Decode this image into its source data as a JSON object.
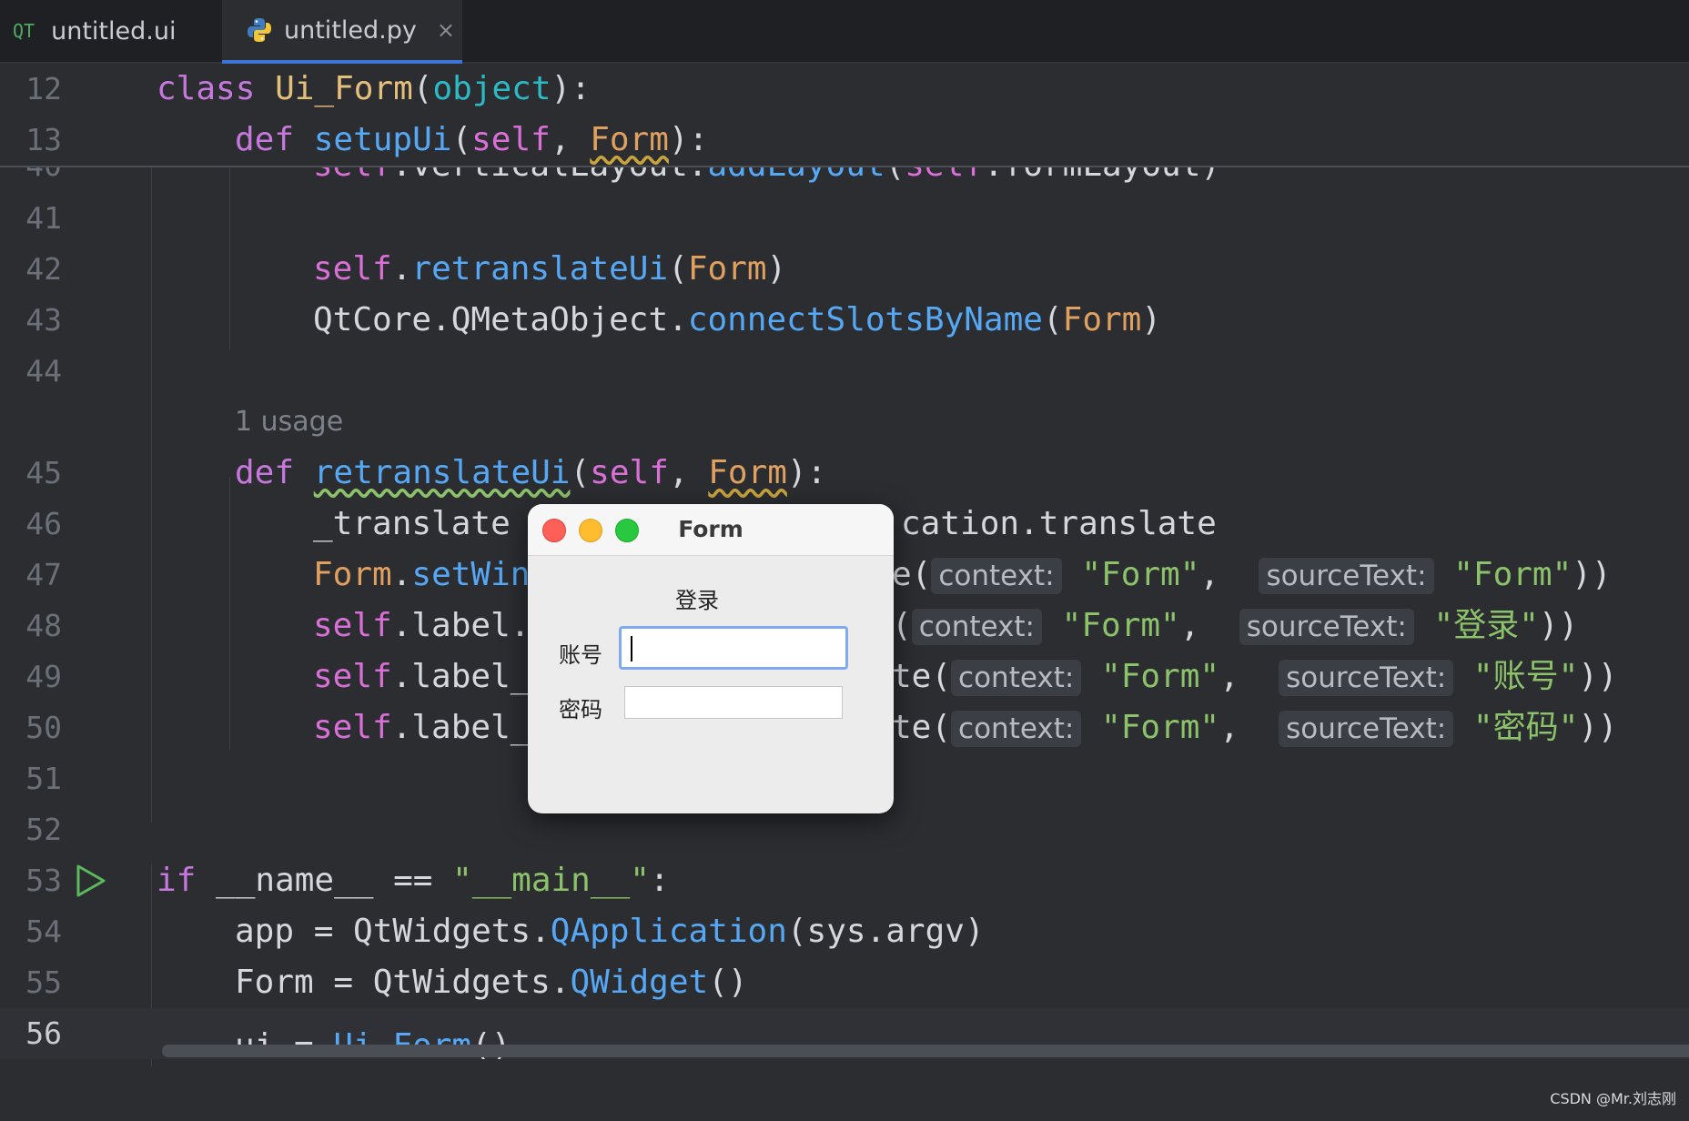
{
  "tabs": [
    {
      "label": "untitled.ui",
      "icon": "qt-icon",
      "icon_text": "QT",
      "active": false
    },
    {
      "label": "untitled.py",
      "icon": "python-icon",
      "active": true,
      "close": "×"
    }
  ],
  "sticky_lines": [
    {
      "num": "12"
    },
    {
      "num": "13"
    }
  ],
  "lines": {
    "l40": "40",
    "l41": "41",
    "l42": "42",
    "l43": "43",
    "l44": "44",
    "l45": "45",
    "l46": "46",
    "l47": "47",
    "l48": "48",
    "l49": "49",
    "l50": "50",
    "l51": "51",
    "l52": "52",
    "l53": "53",
    "l54": "54",
    "l55": "55",
    "l56": "56"
  },
  "code": {
    "c12_kw": "class",
    "c12_cls": "Ui_Form",
    "c12_p1": "(",
    "c12_bi": "object",
    "c12_p2": "):",
    "c13_kw": "def",
    "c13_fn": "setupUi",
    "c13_p1": "(",
    "c13_self": "self",
    "c13_comma": ", ",
    "c13_par": "Form",
    "c13_p2": "):",
    "c40_self": "self",
    "c40_a": ".verticalLayout.",
    "c40_fn": "addLayout",
    "c40_b": "(",
    "c40_self2": "self",
    "c40_c": ".formLayout)",
    "c42_self": "self",
    "c42_a": ".",
    "c42_fn": "retranslateUi",
    "c42_b": "(",
    "c42_par": "Form",
    "c42_c": ")",
    "c43_a": "QtCore.QMetaObject.",
    "c43_fn": "connectSlotsByName",
    "c43_b": "(",
    "c43_par": "Form",
    "c43_c": ")",
    "usage": "1 usage",
    "c45_kw": "def",
    "c45_fn": "retranslateUi",
    "c45_p1": "(",
    "c45_self": "self",
    "c45_comma": ", ",
    "c45_par": "Form",
    "c45_p2": "):",
    "c46_a": "_translate",
    "c46_b": "cation.translate",
    "c47_par": "Form",
    "c47_a": ".",
    "c47_fn": "setWin",
    "c47_b": "e(",
    "c48_self": "self",
    "c48_a": ".label.",
    "c48_b": "(",
    "c49_self": "self",
    "c49_a": ".label_",
    "c49_b": "te(",
    "c50_self": "self",
    "c50_a": ".label_",
    "c50_b": "te(",
    "hint_context": "context:",
    "hint_source": "sourceText:",
    "s_form": "\"Form\"",
    "s_denglu": "\"登录\"",
    "s_zhanghao": "\"账号\"",
    "s_mima": "\"密码\"",
    "comma": ", ",
    "close2": "))",
    "c53_kw": "if",
    "c53_a": " __name__ == ",
    "c53_str": "\"__main__\"",
    "c53_b": ":",
    "c54_a": "app = QtWidgets.",
    "c54_fn": "QApplication",
    "c54_b": "(sys.argv)",
    "c55_a": "Form = QtWidgets.",
    "c55_fn": "QWidget",
    "c55_b": "()",
    "c56_a": "ui = ",
    "c56_fn": "Ui_Form",
    "c56_b": "()"
  },
  "dialog": {
    "title": "Form",
    "heading": "登录",
    "account_label": "账号",
    "account_value": "",
    "password_label": "密码",
    "password_value": ""
  },
  "watermark": "CSDN @Mr.刘志刚",
  "colors": {
    "background": "#2b2d31",
    "keyword": "#c678dd",
    "function": "#56a8f5",
    "string": "#8cc36a",
    "parameter": "#e0a060",
    "active_tab_accent": "#3d74d8"
  }
}
